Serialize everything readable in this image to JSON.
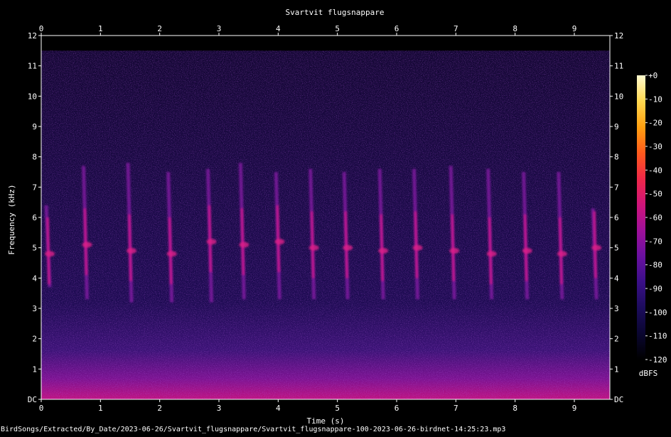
{
  "chart_data": {
    "type": "heatmap",
    "title": "Svartvit flugsnappare",
    "xlabel": "Time (s)",
    "ylabel": "Frequency (kHz)",
    "xlim": [
      0,
      9.6
    ],
    "ylim": [
      0,
      12
    ],
    "x_ticks": [
      0,
      1,
      2,
      3,
      4,
      5,
      6,
      7,
      8,
      9
    ],
    "y_ticks": [
      {
        "value": 0,
        "label": "DC"
      },
      {
        "value": 1,
        "label": "1"
      },
      {
        "value": 2,
        "label": "2"
      },
      {
        "value": 3,
        "label": "3"
      },
      {
        "value": 4,
        "label": "4"
      },
      {
        "value": 5,
        "label": "5"
      },
      {
        "value": 6,
        "label": "6"
      },
      {
        "value": 7,
        "label": "7"
      },
      {
        "value": 8,
        "label": "8"
      },
      {
        "value": 9,
        "label": "9"
      },
      {
        "value": 10,
        "label": "10"
      },
      {
        "value": 11,
        "label": "11"
      },
      {
        "value": 12,
        "label": "12"
      }
    ],
    "colorbar": {
      "label": "dBFS",
      "range": [
        -120,
        0
      ],
      "ticks": [
        "+0",
        "-10",
        "-20",
        "-30",
        "-40",
        "-50",
        "-60",
        "-70",
        "-80",
        "-90",
        "-100",
        "-110",
        "-120"
      ],
      "colors": [
        "#000000",
        "#0a0630",
        "#1c0c5c",
        "#3a0f88",
        "#6a10a0",
        "#a0109a",
        "#d0147a",
        "#f02848",
        "#ff5a1c",
        "#ffa010",
        "#ffd850",
        "#fffbd0"
      ]
    },
    "calls": [
      {
        "time": 0.12,
        "f_low": 3.7,
        "f_high": 6.4,
        "peak": 4.8
      },
      {
        "time": 0.75,
        "f_low": 3.3,
        "f_high": 7.7,
        "peak": 5.1
      },
      {
        "time": 1.5,
        "f_low": 3.2,
        "f_high": 7.8,
        "peak": 4.9
      },
      {
        "time": 2.18,
        "f_low": 3.2,
        "f_high": 7.5,
        "peak": 4.8
      },
      {
        "time": 2.85,
        "f_low": 3.2,
        "f_high": 7.6,
        "peak": 5.2
      },
      {
        "time": 3.4,
        "f_low": 3.3,
        "f_high": 7.8,
        "peak": 5.1
      },
      {
        "time": 4.0,
        "f_low": 3.3,
        "f_high": 7.5,
        "peak": 5.2
      },
      {
        "time": 4.58,
        "f_low": 3.3,
        "f_high": 7.6,
        "peak": 5.0
      },
      {
        "time": 5.15,
        "f_low": 3.3,
        "f_high": 7.5,
        "peak": 5.0
      },
      {
        "time": 5.75,
        "f_low": 3.3,
        "f_high": 7.6,
        "peak": 4.9
      },
      {
        "time": 6.33,
        "f_low": 3.3,
        "f_high": 7.6,
        "peak": 5.0
      },
      {
        "time": 6.95,
        "f_low": 3.3,
        "f_high": 7.7,
        "peak": 4.9
      },
      {
        "time": 7.58,
        "f_low": 3.3,
        "f_high": 7.6,
        "peak": 4.8
      },
      {
        "time": 8.18,
        "f_low": 3.3,
        "f_high": 7.5,
        "peak": 4.9
      },
      {
        "time": 8.77,
        "f_low": 3.3,
        "f_high": 7.5,
        "peak": 4.8
      },
      {
        "time": 9.35,
        "f_low": 3.3,
        "f_high": 6.3,
        "peak": 5.0
      }
    ],
    "grid": false,
    "legend": "right"
  },
  "footer": {
    "file_path": "BirdSongs/Extracted/By_Date/2023-06-26/Svartvit_flugsnappare/Svartvit_flugsnappare-100-2023-06-26-birdnet-14:25:23.mp3"
  }
}
